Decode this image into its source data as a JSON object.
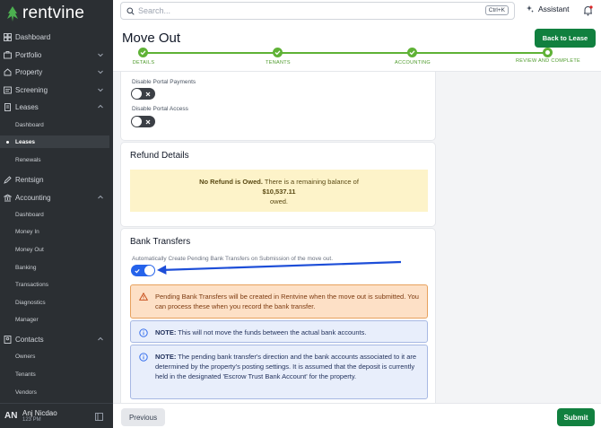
{
  "app": {
    "brand": "rentvine"
  },
  "colors": {
    "brand_green": "#11803f",
    "sidebar_bg": "#2b2f33",
    "step_green": "#5fb236",
    "toggle_blue": "#2563eb",
    "annotation_blue": "#1d4ed8"
  },
  "sidebar": {
    "items": [
      {
        "label": "Dashboard",
        "icon": "dashboard-icon"
      },
      {
        "label": "Portfolio",
        "icon": "portfolio-icon"
      },
      {
        "label": "Property",
        "icon": "property-icon"
      },
      {
        "label": "Screening",
        "icon": "screening-icon"
      },
      {
        "label": "Leases",
        "icon": "leases-icon"
      },
      {
        "label": "Rentsign",
        "icon": "rentsign-icon"
      },
      {
        "label": "Accounting",
        "icon": "accounting-icon"
      },
      {
        "label": "Contacts",
        "icon": "contacts-icon"
      }
    ],
    "leases_sub": [
      "Dashboard",
      "Leases",
      "Renewals"
    ],
    "accounting_sub": [
      "Dashboard",
      "Money In",
      "Money Out",
      "Banking",
      "Transactions",
      "Diagnostics",
      "Manager"
    ],
    "contacts_sub": [
      "Owners",
      "Tenants",
      "Vendors"
    ],
    "user": {
      "initials": "AN",
      "name": "Anj Nicdao",
      "subtitle": "123 PM"
    }
  },
  "topbar": {
    "search_placeholder": "Search...",
    "shortcut": "Ctrl+K",
    "assistant_label": "Assistant"
  },
  "header": {
    "title": "Move Out",
    "back_label": "Back to Lease",
    "steps": [
      "DETAILS",
      "TENANTS",
      "ACCOUNTING",
      "REVIEW AND COMPLETE"
    ]
  },
  "portal": {
    "disable_payments_label": "Disable Portal Payments",
    "disable_access_label": "Disable Portal Access"
  },
  "refund": {
    "title": "Refund Details",
    "bold_text": "No Refund is Owed.",
    "text": "There is a remaining balance of",
    "amount": "$10,537.11",
    "suffix": "owed."
  },
  "bank": {
    "title": "Bank Transfers",
    "auto_label": "Automatically Create Pending Bank Transfers on Submission of the move out.",
    "warning": "Pending Bank Transfers will be created in Rentvine when the move out is submitted. You can process these when you record the bank transfer.",
    "note1_bold": "NOTE:",
    "note1": "This will not move the funds between the actual bank accounts.",
    "note2_bold": "NOTE:",
    "note2": "The pending bank transfer's direction and the bank accounts associated to it are determined by the property's posting settings. It is assumed that the deposit is currently held in the designated 'Escrow Trust Bank Account' for the property."
  },
  "footer": {
    "previous_label": "Previous",
    "submit_label": "Submit"
  }
}
